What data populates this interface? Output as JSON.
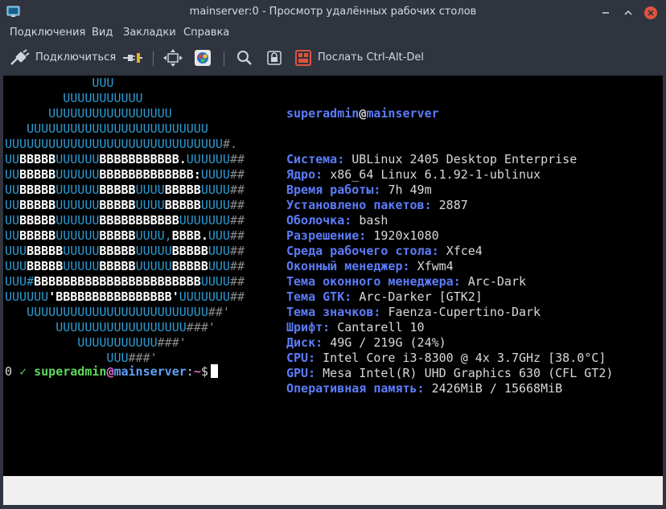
{
  "window": {
    "title": "mainserver:0 - Просмотр удалённых рабочих столов",
    "icons": {
      "app": "remote-desktop-icon",
      "minimize": "minimize-icon",
      "maximize": "maximize-icon",
      "close": "close-icon"
    },
    "colors": {
      "titlebar_bg": "#2f343f",
      "close_button": "#e0533d"
    }
  },
  "menu": {
    "items": [
      "Подключения",
      "Вид",
      "Закладки",
      "Справка"
    ]
  },
  "toolbar": {
    "connect_label": "Подключиться",
    "send_cad_label": "Послать Ctrl-Alt-Del",
    "icons": [
      "plug-connect-icon",
      "plug-disconnect-icon",
      "fullscreen-icon",
      "color-palette-icon",
      "zoom-icon",
      "lock-icon",
      "keyboard-ctrl-alt-del-icon"
    ]
  },
  "terminal": {
    "logo_lines": [
      [
        [
          "u",
          "            UUU"
        ]
      ],
      [
        [
          "u",
          "        UUUUUUUUUUU"
        ]
      ],
      [
        [
          "u",
          "      UUUUUUUUUUUUUUUUU"
        ]
      ],
      [
        [
          "u",
          "   UUUUUUUUUUUUUUUUUUUUUUUUU"
        ]
      ],
      [
        [
          "u",
          "UUUUUUUUUUUUUUUUUUUUUUUUUUUUUU"
        ],
        [
          "h",
          "#."
        ]
      ],
      [
        [
          "u",
          "UU"
        ],
        [
          "b",
          "BBBBB"
        ],
        [
          "u",
          "UUUUUU"
        ],
        [
          "b",
          "BBBBBBBBBBB."
        ],
        [
          "u",
          "UUUUUU"
        ],
        [
          "h",
          "##"
        ]
      ],
      [
        [
          "u",
          "UU"
        ],
        [
          "b",
          "BBBBB"
        ],
        [
          "u",
          "UUUUUU"
        ],
        [
          "b",
          "BBBBBBBBBBBBB:"
        ],
        [
          "u",
          "UUUU"
        ],
        [
          "h",
          "##"
        ]
      ],
      [
        [
          "u",
          "UU"
        ],
        [
          "b",
          "BBBBB"
        ],
        [
          "u",
          "UUUUUU"
        ],
        [
          "b",
          "BBBBB"
        ],
        [
          "u",
          "UUUU"
        ],
        [
          "b",
          "BBBBB"
        ],
        [
          "u",
          "UUUU"
        ],
        [
          "h",
          "##"
        ]
      ],
      [
        [
          "u",
          "UU"
        ],
        [
          "b",
          "BBBBB"
        ],
        [
          "u",
          "UUUUUU"
        ],
        [
          "b",
          "BBBBB"
        ],
        [
          "u",
          "UUUU"
        ],
        [
          "b",
          "BBBBB"
        ],
        [
          "u",
          "UUUU"
        ],
        [
          "h",
          "##"
        ]
      ],
      [
        [
          "u",
          "UU"
        ],
        [
          "b",
          "BBBBB"
        ],
        [
          "u",
          "UUUUUU"
        ],
        [
          "b",
          "BBBBBBBBBBB"
        ],
        [
          "u",
          "UUUUUUU"
        ],
        [
          "h",
          "##"
        ]
      ],
      [
        [
          "u",
          "UU"
        ],
        [
          "b",
          "BBBBB"
        ],
        [
          "u",
          "UUUUUU"
        ],
        [
          "b",
          "BBBBB"
        ],
        [
          "u",
          "UUUU,"
        ],
        [
          "b",
          "BBBB."
        ],
        [
          "u",
          "UUU"
        ],
        [
          "h",
          "##"
        ]
      ],
      [
        [
          "u",
          "UUU"
        ],
        [
          "b",
          "BBBBB"
        ],
        [
          "u",
          "UUUUU"
        ],
        [
          "b",
          "BBBBB"
        ],
        [
          "u",
          "UUUUU"
        ],
        [
          "b",
          "BBBBB"
        ],
        [
          "u",
          "UUU"
        ],
        [
          "h",
          "##"
        ]
      ],
      [
        [
          "u",
          "UUU"
        ],
        [
          "b",
          "BBBBB"
        ],
        [
          "u",
          "UUUUU"
        ],
        [
          "b",
          "BBBBB"
        ],
        [
          "u",
          "UUUUU"
        ],
        [
          "b",
          "BBBBB"
        ],
        [
          "u",
          "UUU"
        ],
        [
          "h",
          "##"
        ]
      ],
      [
        [
          "u",
          "UUU#"
        ],
        [
          "b",
          "BBBBBBBBBBBBBBBBBBBBBBB"
        ],
        [
          "u",
          "UUUU"
        ],
        [
          "h",
          "##"
        ]
      ],
      [
        [
          "u",
          "UUUUUU"
        ],
        [
          "b",
          "'BBBBBBBBBBBBBBBB'"
        ],
        [
          "u",
          "UUUUUUU"
        ],
        [
          "h",
          "##"
        ]
      ],
      [
        [
          "u",
          "   UUUUUUUUUUUUUUUUUUUUUUUUU"
        ],
        [
          "h",
          "##'"
        ]
      ],
      [
        [
          "u",
          "       UUUUUUUUUUUUUUUUUU"
        ],
        [
          "h",
          "###'"
        ]
      ],
      [
        [
          "u",
          "          UUUUUUUUUUU"
        ],
        [
          "h",
          "###'"
        ]
      ],
      [
        [
          "u",
          "              UUU"
        ],
        [
          "h",
          "###'"
        ]
      ]
    ],
    "info_user": "superadmin",
    "info_at": "@",
    "info_host": "mainserver",
    "info": [
      {
        "key": "Система:",
        "value": "UBLinux 2405 Desktop Enterprise"
      },
      {
        "key": "Ядро:",
        "value": "x86_64 Linux 6.1.92-1-ublinux"
      },
      {
        "key": "Время работы:",
        "value": "7h 49m"
      },
      {
        "key": "Установлено пакетов:",
        "value": "2887"
      },
      {
        "key": "Оболочка:",
        "value": "bash"
      },
      {
        "key": "Разрешение:",
        "value": "1920x1080"
      },
      {
        "key": "Среда рабочего стола:",
        "value": "Xfce4"
      },
      {
        "key": "Оконный менеджер:",
        "value": "Xfwm4"
      },
      {
        "key": "Тема оконного менеджера:",
        "value": "Arc-Dark"
      },
      {
        "key": "Тема GTK:",
        "value": "Arc-Darker [GTK2]"
      },
      {
        "key": "Тема значков:",
        "value": "Faenza-Cupertino-Dark"
      },
      {
        "key": "Шрифт:",
        "value": "Cantarell 10"
      },
      {
        "key": "Диск:",
        "value": "49G / 219G (24%)"
      },
      {
        "key": "CPU:",
        "value": "Intel Core i3-8300 @ 4x 3.7GHz [38.0°C]"
      },
      {
        "key": "GPU:",
        "value": "Mesa Intel(R) UHD Graphics 630 (CFL GT2)"
      },
      {
        "key": "Оперативная память:",
        "value": "2426MiB / 15668MiB"
      }
    ],
    "prompt": {
      "exit_code": "0",
      "check": "✓",
      "user": "superadmin",
      "at": "@",
      "host": "mainserver",
      "colon": ":",
      "path": "~",
      "dollar": "$"
    },
    "colors": {
      "logo_u": "#2c9cd4",
      "logo_b": "#ffffff",
      "logo_hash": "#8a8a8a",
      "info_key": "#5c7cfa",
      "prompt_user": "#5fd75f",
      "prompt_at": "#e36bd0",
      "prompt_host": "#5f9ff7"
    }
  }
}
